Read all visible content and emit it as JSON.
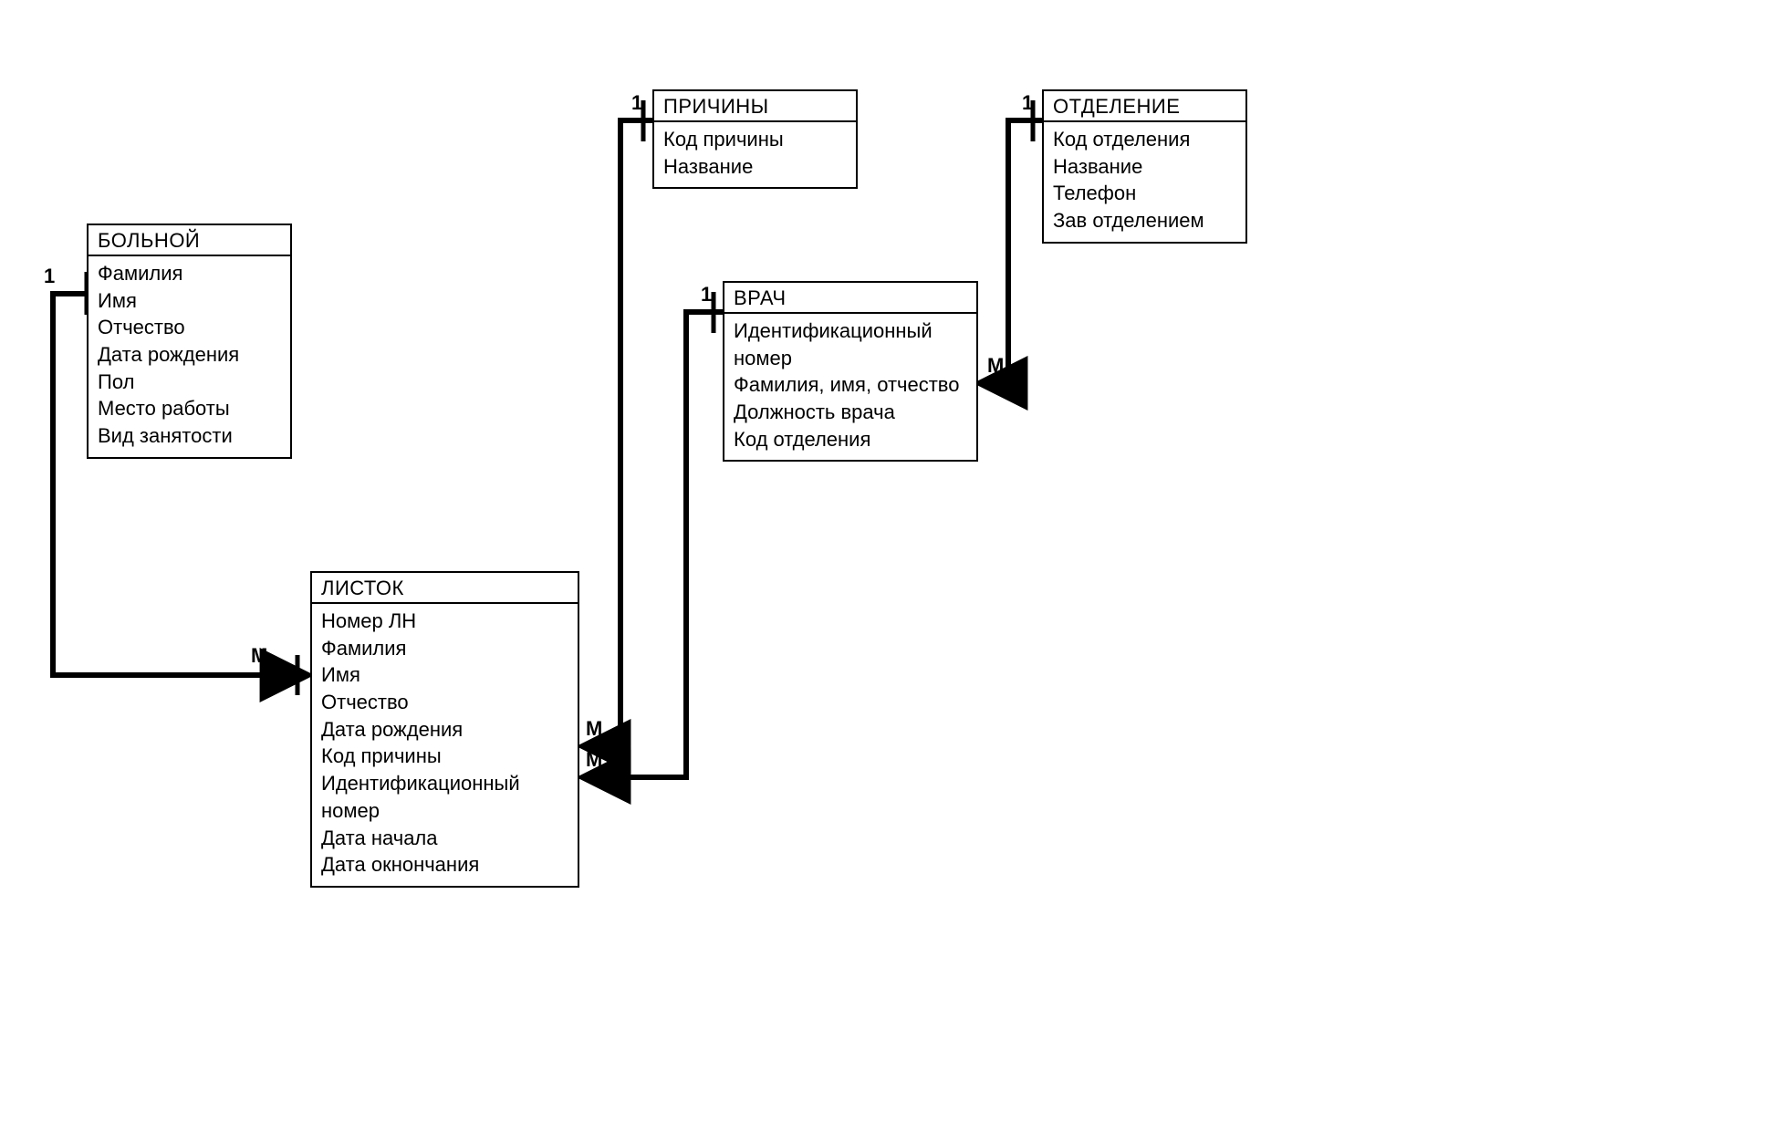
{
  "entities": {
    "patient": {
      "title": "БОЛЬНОЙ",
      "attrs": [
        "Фамилия",
        "Имя",
        "Отчество",
        "Дата рождения",
        "Пол",
        "Место работы",
        "Вид занятости"
      ]
    },
    "sheet": {
      "title": "ЛИСТОК",
      "attrs": [
        "Номер ЛН",
        "Фамилия",
        "Имя",
        "Отчество",
        "Дата рождения",
        "Код причины",
        "Идентификационный номер",
        "Дата начала",
        "Дата окнончания"
      ]
    },
    "reasons": {
      "title": "ПРИЧИНЫ",
      "attrs": [
        "Код причины",
        "Название"
      ]
    },
    "doctor": {
      "title": "ВРАЧ",
      "attrs": [
        "Идентификационный номер",
        "Фамилия, имя, отчество",
        "Должность врача",
        "Код отделения"
      ]
    },
    "department": {
      "title": "ОТДЕЛЕНИЕ",
      "attrs": [
        "Код отделения",
        "Название",
        "Телефон",
        "Зав отделением"
      ]
    }
  },
  "cardinalities": {
    "patient_one": "1",
    "sheet_from_patient_many": "М",
    "reasons_one": "1",
    "sheet_from_reasons_many": "М",
    "doctor_one": "1",
    "sheet_from_doctor_many": "М",
    "department_one": "1",
    "doctor_from_department_many": "М"
  },
  "relationships": [
    {
      "from": "БОЛЬНОЙ",
      "from_card": "1",
      "to": "ЛИСТОК",
      "to_card": "М"
    },
    {
      "from": "ПРИЧИНЫ",
      "from_card": "1",
      "to": "ЛИСТОК",
      "to_card": "М"
    },
    {
      "from": "ВРАЧ",
      "from_card": "1",
      "to": "ЛИСТОК",
      "to_card": "М"
    },
    {
      "from": "ОТДЕЛЕНИЕ",
      "from_card": "1",
      "to": "ВРАЧ",
      "to_card": "М"
    }
  ]
}
